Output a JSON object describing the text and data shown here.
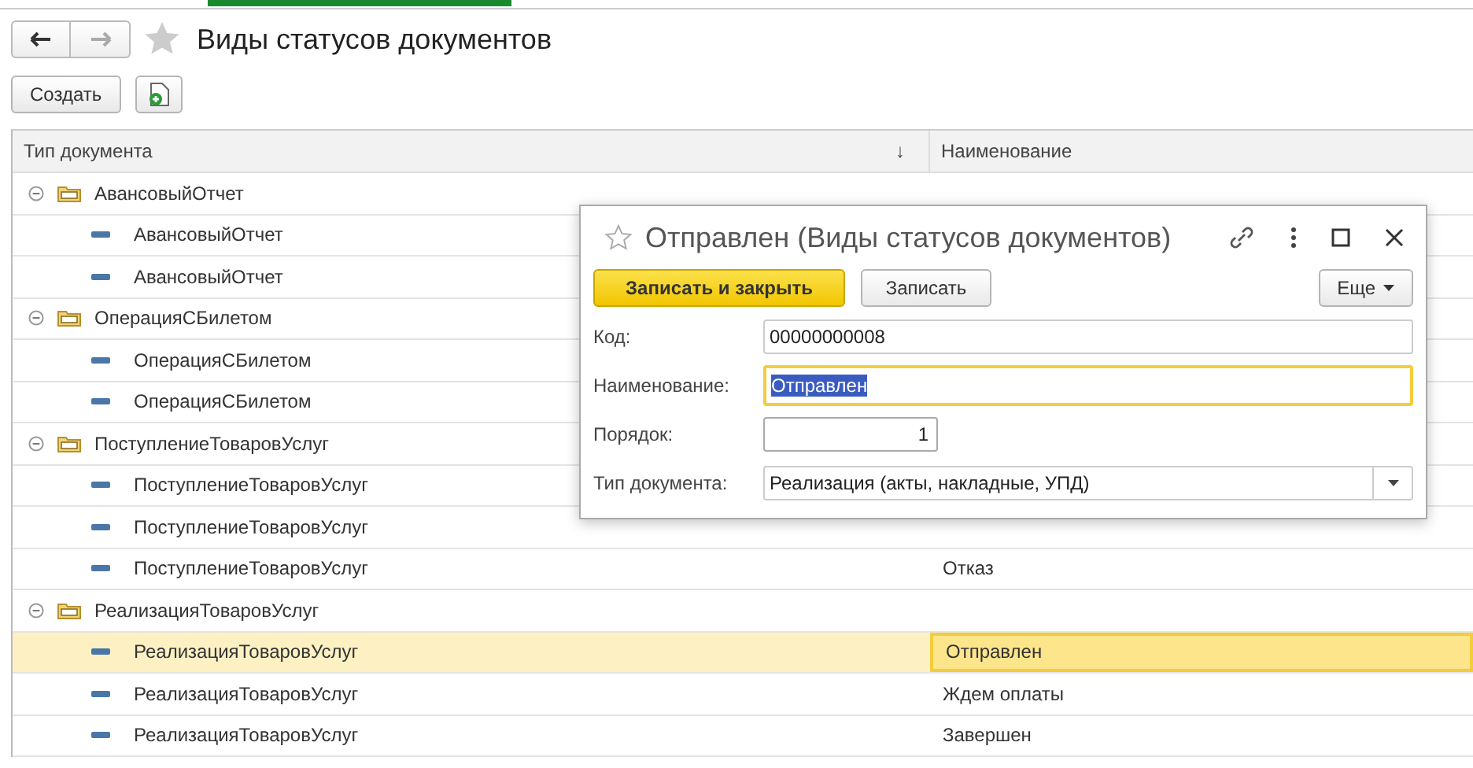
{
  "window": {
    "title": "Виды статусов документов",
    "favorite": false
  },
  "toolbar": {
    "create_button": "Создать"
  },
  "table": {
    "columns": [
      {
        "label": "Тип документа",
        "sort": "↓"
      },
      {
        "label": "Наименование"
      }
    ],
    "rows": [
      {
        "name": "АвансовыйОтчет",
        "expanded": true,
        "children": [
          {
            "name": "АвансовыйОтчет",
            "selected": false
          },
          {
            "name": "АвансовыйОтчет",
            "selected": false
          }
        ]
      },
      {
        "name": "ОперацияСБилетом",
        "expanded": true,
        "children": [
          {
            "name": "ОперацияСБилетом",
            "selected": false
          },
          {
            "name": "ОперацияСБилетом",
            "selected": false
          }
        ]
      },
      {
        "name": "ПоступлениеТоваровУслуг",
        "expanded": true,
        "children": [
          {
            "name": "ПоступлениеТоваровУслуг",
            "selected": false
          },
          {
            "name": "ПоступлениеТоваровУслуг",
            "selected": false
          },
          {
            "name": "ПоступлениеТоваровУслуг",
            "status": "Отказ",
            "selected": false
          }
        ]
      },
      {
        "name": "РеализацияТоваровУслуг",
        "expanded": true,
        "children": [
          {
            "name": "РеализацияТоваровУслуг",
            "status": "Отправлен",
            "selected": true
          },
          {
            "name": "РеализацияТоваровУслуг",
            "status": "Ждем оплаты",
            "selected": false
          },
          {
            "name": "РеализацияТоваровУслуг",
            "status": "Завершен",
            "selected": false
          }
        ]
      }
    ]
  },
  "dialog": {
    "title": "Отправлен (Виды статусов документов)",
    "favorite": false,
    "buttons": {
      "save_close": "Записать и закрыть",
      "save": "Записать",
      "more": "Еще"
    },
    "fields": [
      {
        "label": "Код:",
        "value": "00000000008",
        "kind": "text",
        "focused": false
      },
      {
        "label": "Наименование:",
        "value": "Отправлен",
        "kind": "text",
        "focused": true
      },
      {
        "label": "Порядок:",
        "value": "1",
        "kind": "number",
        "focused": false
      },
      {
        "label": "Тип документа:",
        "value": "Реализация (акты, накладные, УПД)",
        "kind": "select",
        "focused": false
      }
    ]
  }
}
